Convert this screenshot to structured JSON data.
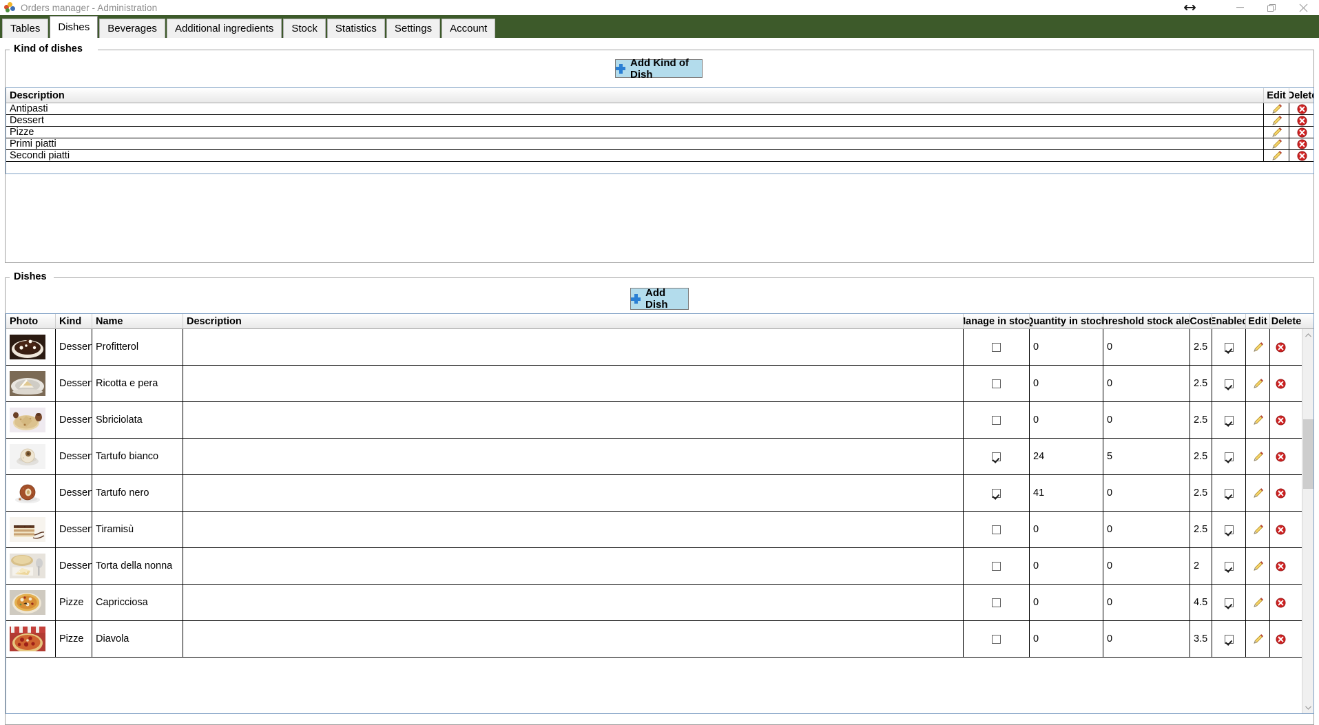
{
  "window": {
    "title": "Orders manager - Administration",
    "icon": "app-palette-icon",
    "controls": {
      "resize": "resize-horizontal-icon",
      "minimize": "minimize-icon",
      "maximize": "maximize-restore-icon",
      "close": "close-icon"
    },
    "accent_green": "#3d5a2a"
  },
  "tabs": [
    {
      "label": "Tables",
      "active": false
    },
    {
      "label": "Dishes",
      "active": true
    },
    {
      "label": "Beverages",
      "active": false
    },
    {
      "label": "Additional ingredients",
      "active": false
    },
    {
      "label": "Stock",
      "active": false
    },
    {
      "label": "Statistics",
      "active": false
    },
    {
      "label": "Settings",
      "active": false
    },
    {
      "label": "Account",
      "active": false
    }
  ],
  "kind_of_dishes": {
    "legend": "Kind of dishes",
    "add_button": "Add Kind of Dish",
    "columns": [
      "Description",
      "Edit",
      "Delete"
    ],
    "rows": [
      {
        "description": "Antipasti"
      },
      {
        "description": "Dessert"
      },
      {
        "description": "Pizze"
      },
      {
        "description": "Primi piatti"
      },
      {
        "description": "Secondi piatti"
      }
    ]
  },
  "dishes": {
    "legend": "Dishes",
    "add_button": "Add Dish",
    "columns": [
      "Photo",
      "Kind",
      "Name",
      "Description",
      "Manage in stock",
      "Quantity in stock",
      "Threshold stock alert",
      "Cost",
      "Enabled",
      "Edit",
      "Delete"
    ],
    "rows": [
      {
        "photo": "profitterol",
        "kind": "Dessert",
        "name": "Profitterol",
        "description": "",
        "manage_in_stock": false,
        "quantity_in_stock": "0",
        "threshold_stock_alert": "0",
        "cost": "2.5",
        "enabled": true
      },
      {
        "photo": "ricotta-e-pera",
        "kind": "Dessert",
        "name": "Ricotta e pera",
        "description": "",
        "manage_in_stock": false,
        "quantity_in_stock": "0",
        "threshold_stock_alert": "0",
        "cost": "2.5",
        "enabled": true
      },
      {
        "photo": "sbriciolata",
        "kind": "Dessert",
        "name": "Sbriciolata",
        "description": "",
        "manage_in_stock": false,
        "quantity_in_stock": "0",
        "threshold_stock_alert": "0",
        "cost": "2.5",
        "enabled": true
      },
      {
        "photo": "tartufo-bianco",
        "kind": "Dessert",
        "name": "Tartufo bianco",
        "description": "",
        "manage_in_stock": true,
        "quantity_in_stock": "24",
        "threshold_stock_alert": "5",
        "cost": "2.5",
        "enabled": true
      },
      {
        "photo": "tartufo-nero",
        "kind": "Dessert",
        "name": "Tartufo nero",
        "description": "",
        "manage_in_stock": true,
        "quantity_in_stock": "41",
        "threshold_stock_alert": "0",
        "cost": "2.5",
        "enabled": true
      },
      {
        "photo": "tiramisu",
        "kind": "Dessert",
        "name": "Tiramisù",
        "description": "",
        "manage_in_stock": false,
        "quantity_in_stock": "0",
        "threshold_stock_alert": "0",
        "cost": "2.5",
        "enabled": true
      },
      {
        "photo": "torta-della-nonna",
        "kind": "Dessert",
        "name": "Torta della nonna",
        "description": "",
        "manage_in_stock": false,
        "quantity_in_stock": "0",
        "threshold_stock_alert": "0",
        "cost": "2",
        "enabled": true
      },
      {
        "photo": "capricciosa",
        "kind": "Pizze",
        "name": "Capricciosa",
        "description": "",
        "manage_in_stock": false,
        "quantity_in_stock": "0",
        "threshold_stock_alert": "0",
        "cost": "4.5",
        "enabled": true
      },
      {
        "photo": "diavola",
        "kind": "Pizze",
        "name": "Diavola",
        "description": "",
        "manage_in_stock": false,
        "quantity_in_stock": "0",
        "threshold_stock_alert": "0",
        "cost": "3.5",
        "enabled": true
      }
    ],
    "scrollbar": {
      "up_arrow": "chevron-up-icon",
      "down_arrow": "chevron-down-icon"
    }
  },
  "icons": {
    "edit": "pencil-icon",
    "delete": "delete-circle-icon",
    "add": "plus-icon"
  }
}
